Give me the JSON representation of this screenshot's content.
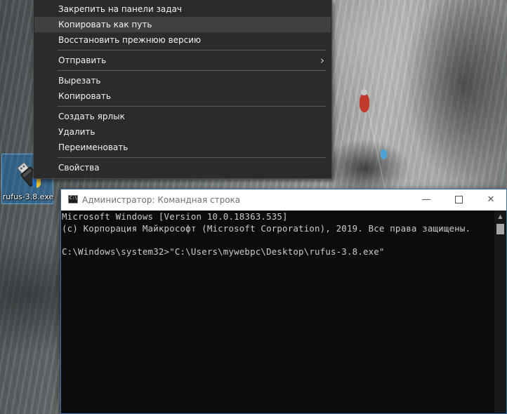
{
  "desktop": {
    "icon": {
      "label": "rufus-3.8.exe",
      "icon": "usb-drive-icon"
    }
  },
  "context_menu": {
    "items": [
      {
        "label": "Закрепить на панели задач"
      },
      {
        "label": "Копировать как путь"
      },
      {
        "label": "Восстановить прежнюю версию"
      },
      {
        "label": "Отправить",
        "submenu_icon": "chevron-right-icon"
      },
      {
        "label": "Вырезать"
      },
      {
        "label": "Копировать"
      },
      {
        "label": "Создать ярлык"
      },
      {
        "label": "Удалить"
      },
      {
        "label": "Переименовать"
      },
      {
        "label": "Свойства"
      }
    ],
    "highlighted": "Копировать как путь"
  },
  "cmd_window": {
    "title": "Администратор: Командная строка",
    "icon": "cmd-icon",
    "icon_text": "C:\\",
    "controls": {
      "minimize": "—",
      "close": "✕"
    },
    "lines": [
      "Microsoft Windows [Version 10.0.18363.535]",
      "(c) Корпорация Майкрософт (Microsoft Corporation), 2019. Все права защищены.",
      "",
      "C:\\Windows\\system32>\"C:\\Users\\mywebpc\\Desktop\\rufus-3.8.exe\""
    ]
  },
  "colors": {
    "menu_bg": "#2b2b2b",
    "menu_hover": "#414141",
    "console_bg": "#0c0c0c",
    "console_text": "#cccccc",
    "selection": "#0078d7"
  }
}
